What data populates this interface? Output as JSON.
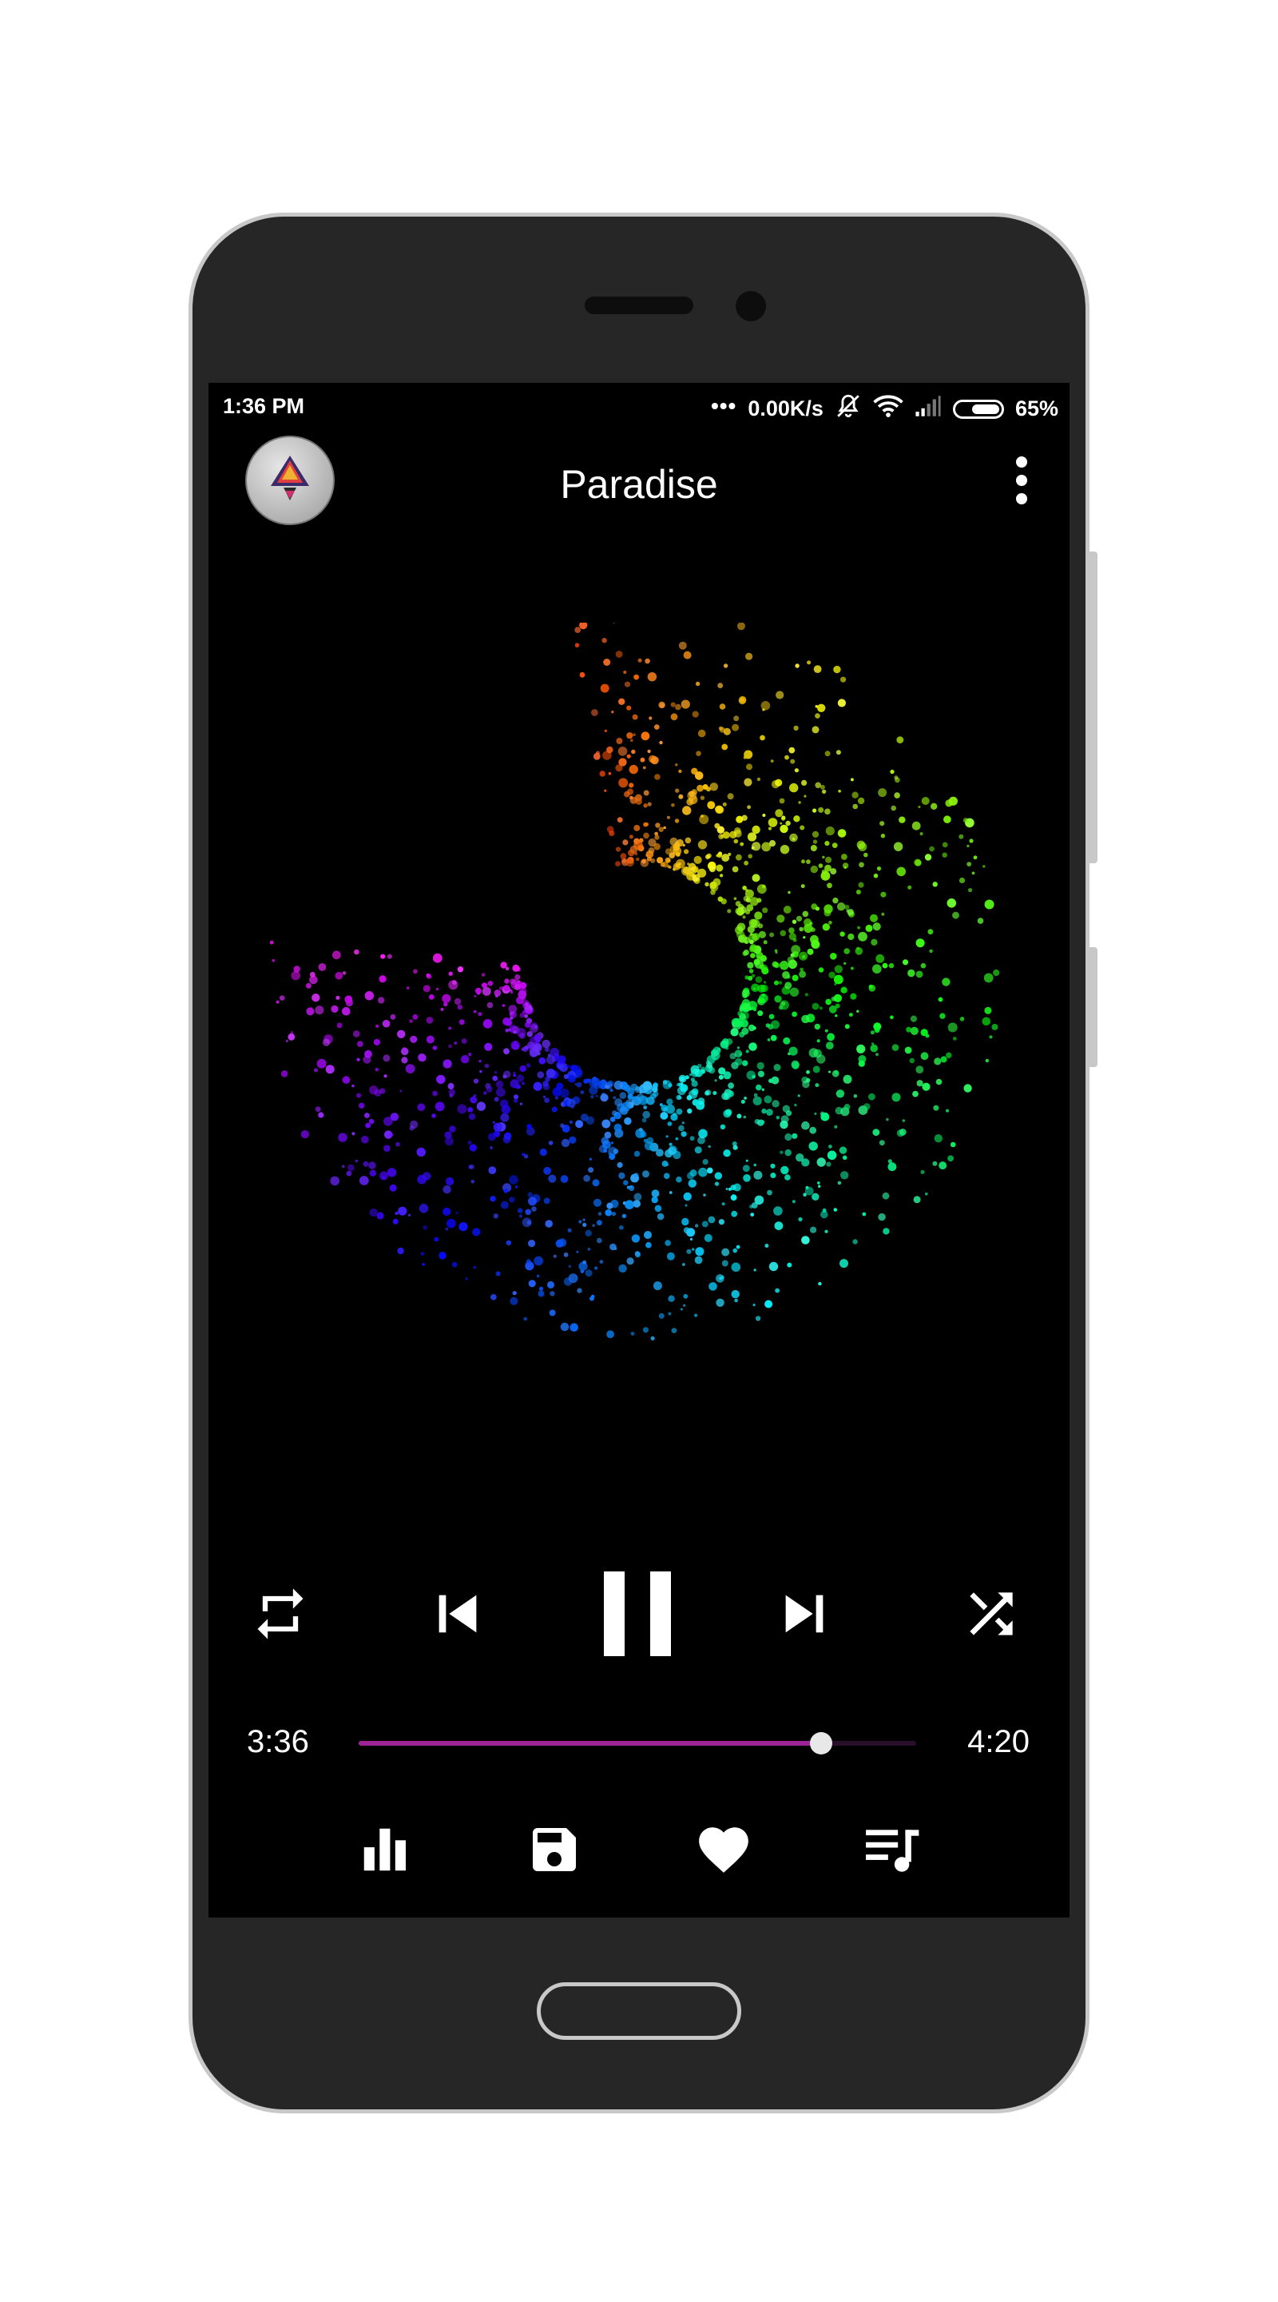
{
  "status_bar": {
    "time": "1:36 PM",
    "network_speed": "0.00K/s",
    "battery_percent": "65%",
    "battery_level": 0.65,
    "icons": [
      "more-dots-icon",
      "bell-muted-icon",
      "wifi-icon",
      "signal-icon",
      "battery-icon"
    ]
  },
  "header": {
    "title": "Paradise",
    "avatar_icon": "album-art-avatar",
    "menu_icon": "more-vertical-icon"
  },
  "controls": {
    "repeat_icon": "repeat-icon",
    "previous_icon": "skip-previous-icon",
    "play_state_icon": "pause-icon",
    "next_icon": "skip-next-icon",
    "shuffle_icon": "shuffle-icon"
  },
  "seek": {
    "current_time": "3:36",
    "total_time": "4:20",
    "progress": 0.83
  },
  "actions": {
    "icons": [
      "equalizer-icon",
      "save-icon",
      "favorite-icon",
      "playlist-icon"
    ]
  },
  "colors": {
    "screen_background": "#000000",
    "progress_accent": "#9c2496",
    "phone_body": "#262626"
  }
}
